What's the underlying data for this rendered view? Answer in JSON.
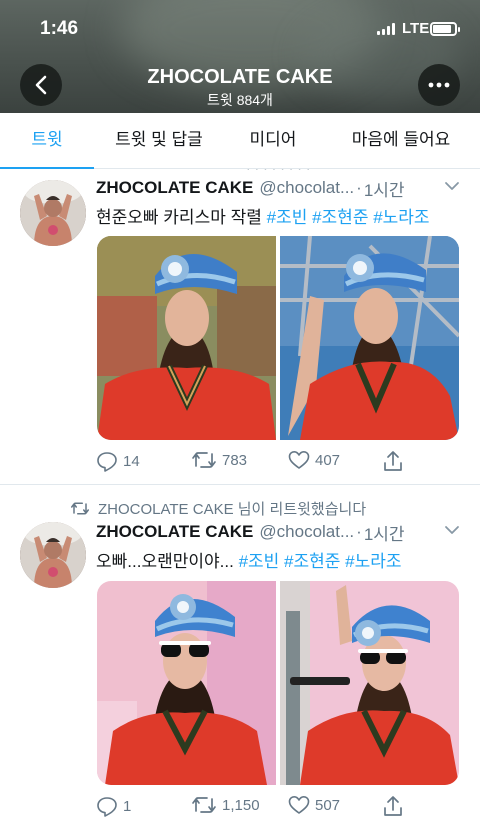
{
  "status_bar": {
    "time": "1:46",
    "network": "LTE",
    "battery_level": 0.85
  },
  "header": {
    "title": "ZHOCOLATE CAKE",
    "subtitle": "트윗 884개"
  },
  "tabs": [
    {
      "label": "트윗",
      "active": true
    },
    {
      "label": "트윗 및 답글",
      "active": false
    },
    {
      "label": "미디어",
      "active": false
    },
    {
      "label": "마음에 들어요",
      "active": false
    }
  ],
  "tweets": [
    {
      "retweet_note": "",
      "name": "ZHOCOLATE CAKE",
      "handle": "@chocolat...",
      "separator": "·",
      "time": "1시간",
      "text_plain": "현준오빠 카리스마 작렬",
      "hashtags": [
        "#조빈",
        "#조현준",
        "#노라조"
      ],
      "replies": "14",
      "retweets": "783",
      "likes": "407"
    },
    {
      "retweet_note": "ZHOCOLATE CAKE 님이 리트윗했습니다",
      "name": "ZHOCOLATE CAKE",
      "handle": "@chocolat...",
      "separator": "·",
      "time": "1시간",
      "text_plain": "오빠...오랜만이야...",
      "hashtags": [
        "#조빈",
        "#조현준",
        "#노라조"
      ],
      "replies": "1",
      "retweets": "1,150",
      "likes": "507"
    }
  ],
  "colors": {
    "accent": "#1da1f2",
    "secondary_text": "#657786",
    "divider": "#e1e8ed",
    "header_bg": "#4a524e"
  }
}
